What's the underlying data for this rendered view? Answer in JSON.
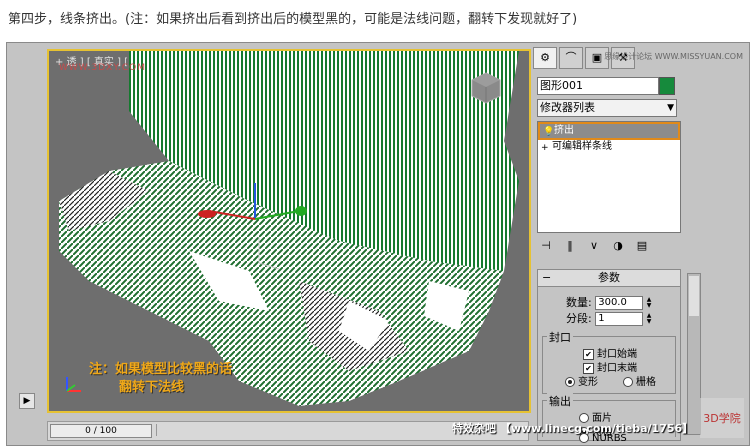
{
  "caption": "第四步，线条挤出。(注：如果挤出后看到挤出后的模型黑的，可能是法线问题，翻转下发现就好了)",
  "viewport": {
    "label": "+ 透 ] [ 真实 ] [",
    "watermark": "WWW.3DXY.COM",
    "note_line1": "注：如果模型比较黑的话",
    "note_line2": "翻转下法线",
    "accent_color": "#e6c233",
    "mesh_color": "#157a2e"
  },
  "timeline": {
    "slider_label": "0 / 100"
  },
  "panel": {
    "watermark": "思缘设计论坛 WWW.MISSYUAN.COM",
    "tabs": [
      "gear-icon",
      "arc-icon",
      "display-icon",
      "util-icon"
    ],
    "object_name": "图形001",
    "object_color": "#168a3c",
    "modifier_list": "修改器列表",
    "stack": [
      {
        "label": "挤出",
        "selected": true
      },
      {
        "label": "可编辑样条线",
        "selected": false
      }
    ],
    "params": {
      "title": "参数",
      "amount_label": "数量:",
      "amount_value": "300.0",
      "segments_label": "分段:",
      "segments_value": "1",
      "cap_group": "封口",
      "cap_start": "封口始端",
      "cap_end": "封口末端",
      "morph": "变形",
      "grid": "栅格",
      "output_group": "输出",
      "patch": "面片",
      "mesh": "网格",
      "nurbs": "NURBS"
    }
  },
  "footer_watermark": "特效杂吧 【www.linecg.com/tieba/1756】",
  "logo_text": "3D学院"
}
